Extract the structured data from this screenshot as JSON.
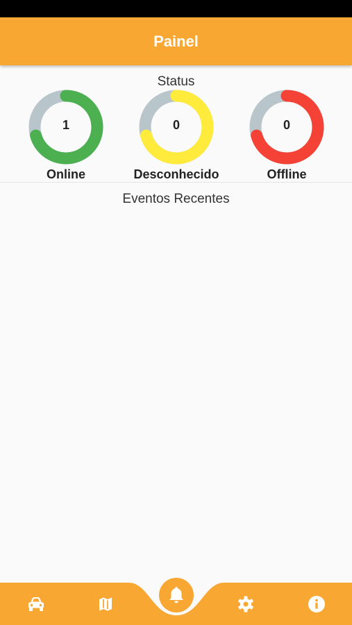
{
  "appbar": {
    "title": "Painel",
    "color": "#f8a832"
  },
  "status": {
    "title": "Status",
    "gauges": [
      {
        "label": "Online",
        "value": "1",
        "color": "#4caf50"
      },
      {
        "label": "Desconhecido",
        "value": "0",
        "color": "#ffeb3b"
      },
      {
        "label": "Offline",
        "value": "0",
        "color": "#f44336"
      }
    ],
    "track_color": "#b8c5ca"
  },
  "events": {
    "title": "Eventos Recentes"
  },
  "bottom_nav": {
    "items": [
      {
        "icon": "car-icon"
      },
      {
        "icon": "map-icon"
      },
      {
        "icon": "bell-icon",
        "active": true
      },
      {
        "icon": "gear-icon"
      },
      {
        "icon": "info-icon"
      }
    ]
  }
}
